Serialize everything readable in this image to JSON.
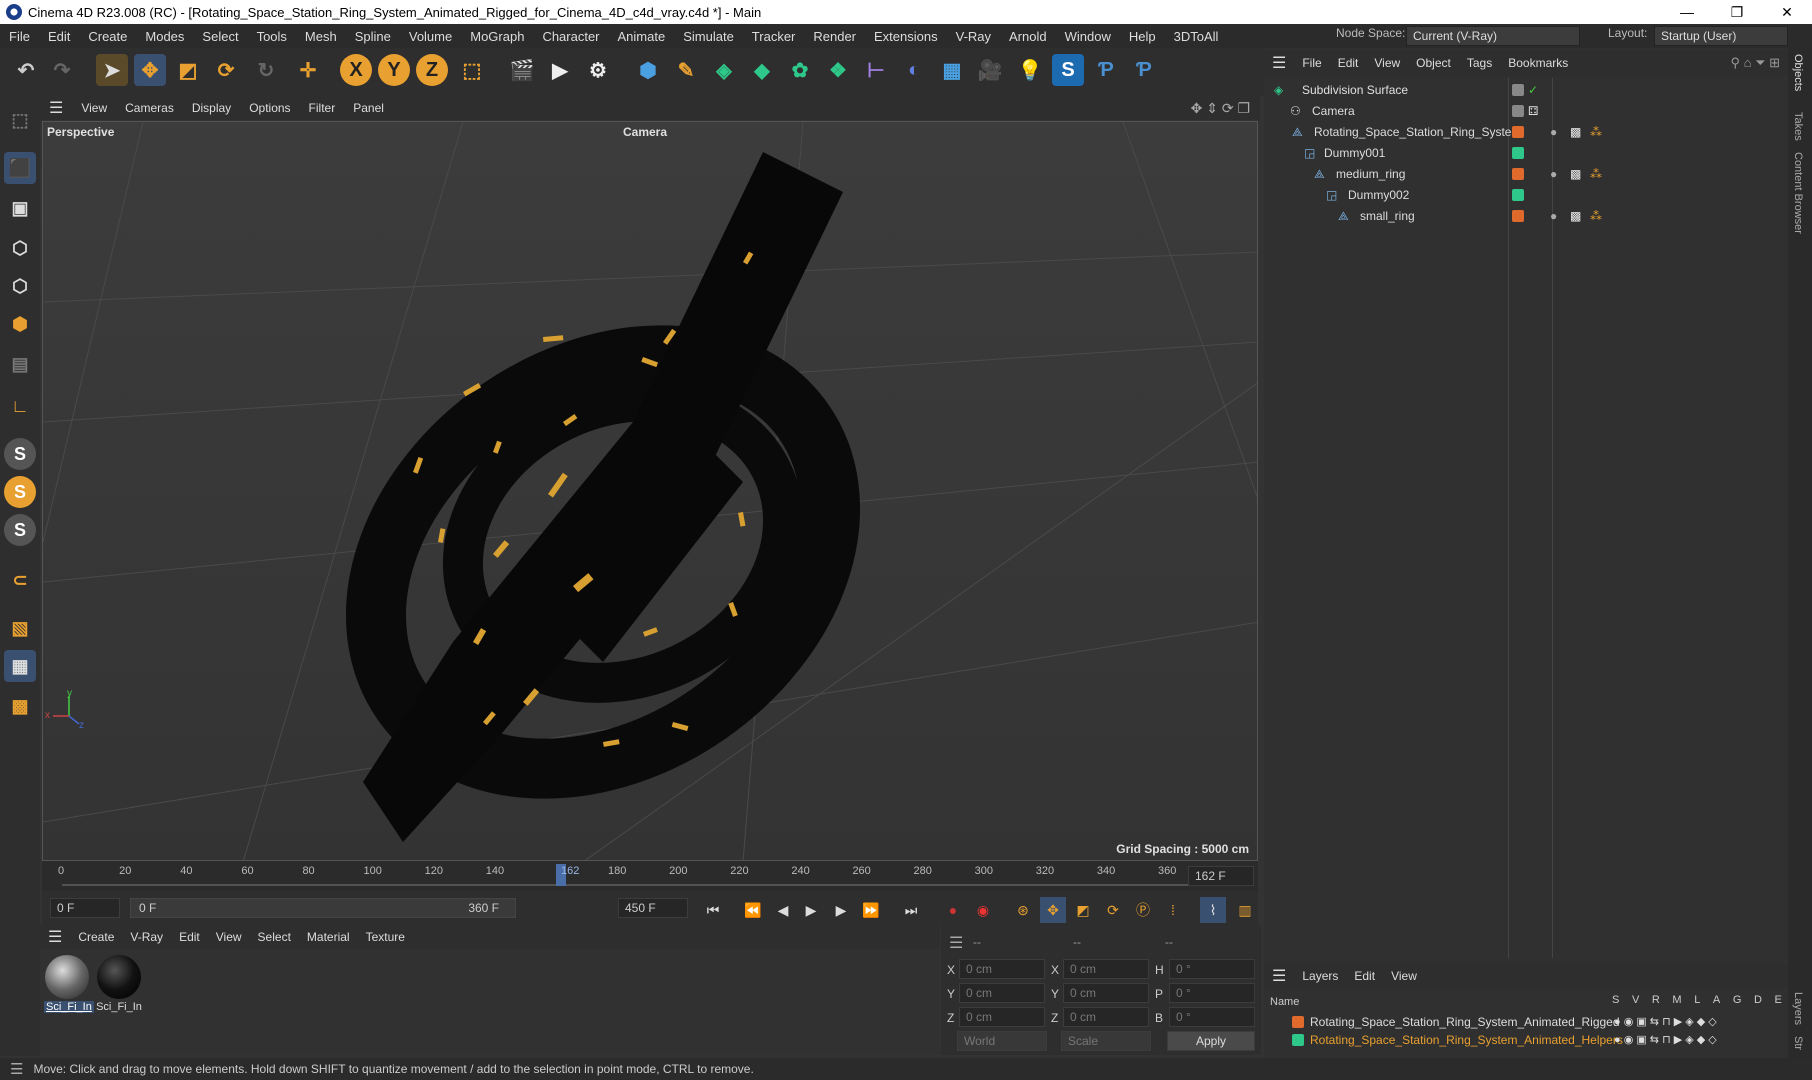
{
  "window": {
    "title": "Cinema 4D R23.008 (RC) - [Rotating_Space_Station_Ring_System_Animated_Rigged_for_Cinema_4D_c4d_vray.c4d *] - Main",
    "minimize": "—",
    "maximize": "❐",
    "close": "✕"
  },
  "menubar": [
    "File",
    "Edit",
    "Create",
    "Modes",
    "Select",
    "Tools",
    "Mesh",
    "Spline",
    "Volume",
    "MoGraph",
    "Character",
    "Animate",
    "Simulate",
    "Tracker",
    "Render",
    "Extensions",
    "V-Ray",
    "Arnold",
    "Window",
    "Help",
    "3DToAll"
  ],
  "node_space": {
    "label": "Node Space:",
    "value": "Current (V-Ray)"
  },
  "layout": {
    "label": "Layout:",
    "value": "Startup (User)"
  },
  "viewport": {
    "menu": [
      "View",
      "Cameras",
      "Display",
      "Options",
      "Filter",
      "Panel"
    ],
    "name": "Perspective",
    "camera": "Camera",
    "grid_spacing": "Grid Spacing : 5000 cm",
    "axis_x": "x",
    "axis_y": "y",
    "axis_z": "z"
  },
  "timeline": {
    "ticks": [
      "0",
      "20",
      "40",
      "60",
      "80",
      "100",
      "120",
      "140",
      "162",
      "180",
      "200",
      "220",
      "240",
      "260",
      "280",
      "300",
      "320",
      "340",
      "360"
    ],
    "current": "162 F"
  },
  "playbar": {
    "start": "0 F",
    "range_start": "0 F",
    "range_end": "360 F",
    "end": "450 F"
  },
  "materials": {
    "menu": [
      "Create",
      "V-Ray",
      "Edit",
      "View",
      "Select",
      "Material",
      "Texture"
    ],
    "items": [
      {
        "label": "Sci_Fi_In"
      },
      {
        "label": "Sci_Fi_In"
      }
    ]
  },
  "attributes": {
    "header": [
      "--",
      "--",
      "--"
    ],
    "rows": [
      {
        "a": "X",
        "av": "0 cm",
        "b": "X",
        "bv": "0 cm",
        "c": "H",
        "cv": "0 °"
      },
      {
        "a": "Y",
        "av": "0 cm",
        "b": "Y",
        "bv": "0 cm",
        "c": "P",
        "cv": "0 °"
      },
      {
        "a": "Z",
        "av": "0 cm",
        "b": "Z",
        "bv": "0 cm",
        "c": "B",
        "cv": "0 °"
      }
    ],
    "world": "World",
    "scale": "Scale",
    "apply": "Apply"
  },
  "objects": {
    "menu": [
      "File",
      "Edit",
      "View",
      "Object",
      "Tags",
      "Bookmarks"
    ],
    "items": [
      {
        "name": "Subdivision Surface",
        "color": "#888888"
      },
      {
        "name": "Camera",
        "color": "#888888"
      },
      {
        "name": "Rotating_Space_Station_Ring_System",
        "color": "#e06a2c"
      },
      {
        "name": "Dummy001",
        "color": "#2ec98a"
      },
      {
        "name": "medium_ring",
        "color": "#e06a2c"
      },
      {
        "name": "Dummy002",
        "color": "#2ec98a"
      },
      {
        "name": "small_ring",
        "color": "#e06a2c"
      }
    ]
  },
  "layers": {
    "menu": [
      "Layers",
      "Edit",
      "View"
    ],
    "header_name": "Name",
    "columns": [
      "S",
      "V",
      "R",
      "M",
      "L",
      "A",
      "G",
      "D",
      "E"
    ],
    "items": [
      {
        "name": "Rotating_Space_Station_Ring_System_Animated_Rigged",
        "color": "#e06a2c"
      },
      {
        "name": "Rotating_Space_Station_Ring_System_Animated_Helpers",
        "color": "#2ec98a"
      }
    ]
  },
  "side_tabs": [
    "Objects",
    "Takes",
    "Content Browser",
    "Layers",
    "Str"
  ],
  "status": "Move: Click and drag to move elements. Hold down SHIFT to quantize movement / add to the selection in point mode, CTRL to remove."
}
